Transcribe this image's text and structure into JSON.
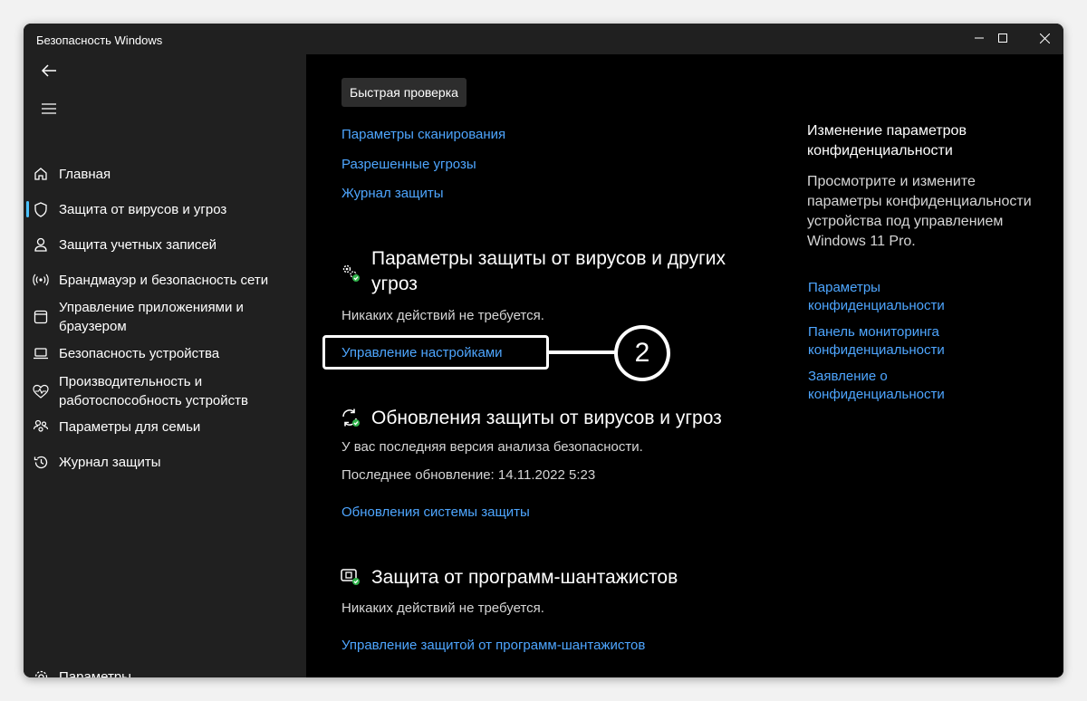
{
  "window": {
    "title": "Безопасность Windows"
  },
  "sidebar": {
    "items": [
      {
        "label": "Главная"
      },
      {
        "label": "Защита от вирусов и угроз"
      },
      {
        "label": "Защита учетных записей"
      },
      {
        "label": "Брандмауэр и безопасность сети"
      },
      {
        "label": "Управление приложениями и браузером"
      },
      {
        "label": "Безопасность устройства"
      },
      {
        "label": "Производительность и работоспособность устройств"
      },
      {
        "label": "Параметры для семьи"
      },
      {
        "label": "Журнал защиты"
      }
    ],
    "settings_label": "Параметры",
    "active_index": 1
  },
  "main": {
    "quick_scan_label": "Быстрая проверка",
    "scan_links": [
      "Параметры сканирования",
      "Разрешенные угрозы",
      "Журнал защиты"
    ],
    "sections": {
      "settings": {
        "title": "Параметры защиты от вирусов и других угроз",
        "status": "Никаких действий не требуется.",
        "link": "Управление настройками"
      },
      "updates": {
        "title": "Обновления защиты от вирусов и угроз",
        "status": "У вас последняя версия анализа безопасности.",
        "last_update": "Последнее обновление: 14.11.2022 5:23",
        "link": "Обновления системы защиты"
      },
      "ransomware": {
        "title": "Защита от программ-шантажистов",
        "status": "Никаких действий не требуется.",
        "link": "Управление защитой от программ-шантажистов"
      }
    }
  },
  "right_panel": {
    "title": "Изменение параметров конфиденциальности",
    "description": "Просмотрите и измените параметры конфиденциальности устройства под управлением Windows 11 Pro.",
    "links": [
      "Параметры конфиденциальности",
      "Панель мониторинга конфиденциальности",
      "Заявление о конфиденциальности"
    ]
  },
  "callout": {
    "number": "2"
  },
  "colors": {
    "accent": "#4cc2ff",
    "link": "#4ea6ff",
    "ok_green": "#2fb34a"
  }
}
